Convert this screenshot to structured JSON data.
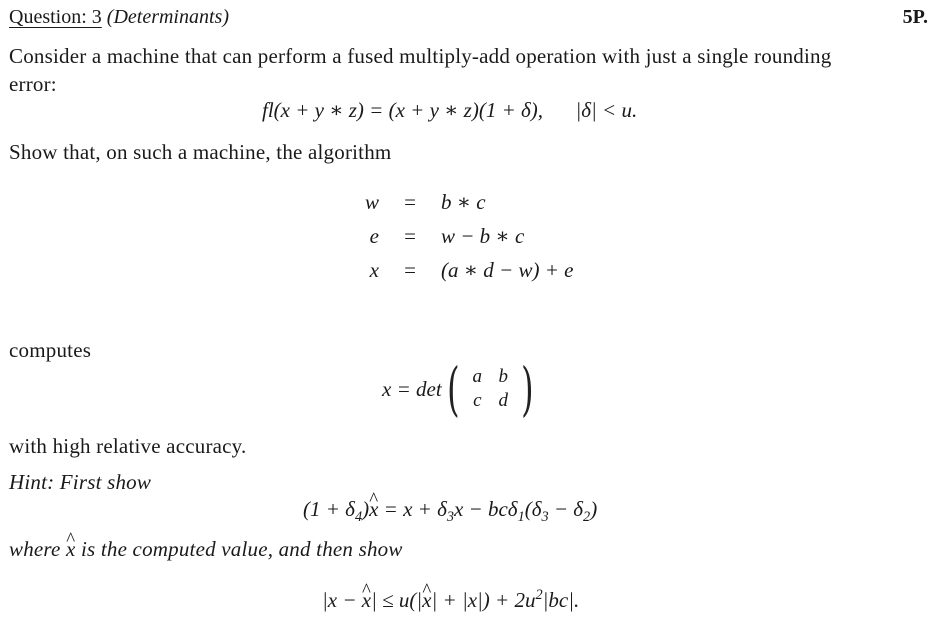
{
  "header": {
    "question_label": "Question: 3",
    "topic": "(Determinants)",
    "points": "5P."
  },
  "intro": {
    "line1": "Consider a machine that can perform a fused multiply-add operation with just a single rounding",
    "line2": "error:"
  },
  "fma_equation": {
    "lhs": "fl(x + y ∗ z) = (x + y ∗ z)(1 + δ),",
    "condition": "|δ| < u."
  },
  "algorithm_intro": "Show that, on such a machine, the algorithm",
  "algorithm": [
    {
      "lhs": "w",
      "rel": "=",
      "rhs": "b ∗ c"
    },
    {
      "lhs": "e",
      "rel": "=",
      "rhs": "w − b ∗ c"
    },
    {
      "lhs": "x",
      "rel": "=",
      "rhs": "(a ∗ d − w) + e"
    }
  ],
  "computes_label": "computes",
  "determinant": {
    "lhs": "x = det",
    "matrix": [
      [
        "a",
        "b"
      ],
      [
        "c",
        "d"
      ]
    ]
  },
  "accuracy_text": "with high relative accuracy.",
  "hint": {
    "label": "Hint: First show",
    "equation_parts": {
      "a": "(1 + δ",
      "a_sub": "4",
      "b": ")",
      "xhat": "x",
      "c": " = x + δ",
      "c_sub": "3",
      "d": "x − bcδ",
      "d_sub": "1",
      "e": "(δ",
      "e_sub": "3",
      "f": " − δ",
      "f_sub": "2",
      "g": ")"
    },
    "where_text_1": "where ",
    "where_xhat": "x",
    "where_text_2": " is the computed value, and then show"
  },
  "final_inequality": {
    "p1": "|x − ",
    "xhat1": "x",
    "p2": "| ≤ u(|",
    "xhat2": "x",
    "p3": "| + |x|) + 2u",
    "sup": "2",
    "p4": "|bc|."
  }
}
